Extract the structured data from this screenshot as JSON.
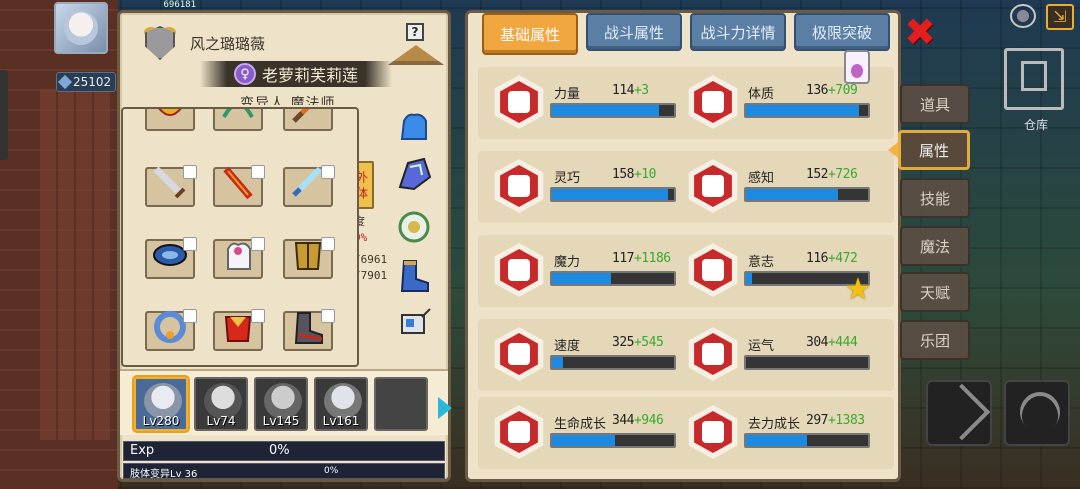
{
  "hud": {
    "hp_text": "696181",
    "power_value": "25102"
  },
  "character": {
    "class_name": "风之璐璐薇",
    "hero_name": "老萝莉芙莉莲",
    "hero_symbol": "♀",
    "subtitle": "变异人 魔法师",
    "help_glyph": "?",
    "extra_tab_label": "外 体",
    "partial_texts": [
      "度",
      "0%",
      "/6961",
      "/7901"
    ]
  },
  "team": [
    {
      "level": "Lv280",
      "selected": true
    },
    {
      "level": "Lv74",
      "selected": false
    },
    {
      "level": "Lv145",
      "selected": false
    },
    {
      "level": "Lv161",
      "selected": false
    },
    {
      "level": "",
      "selected": false
    }
  ],
  "exp": {
    "label": "Exp",
    "value": "0%"
  },
  "limb": {
    "label": "肢体变异Lv 36",
    "value": "0%"
  },
  "tabs": [
    {
      "label": "基础属性",
      "active": true
    },
    {
      "label": "战斗属性",
      "active": false
    },
    {
      "label": "战斗力详情",
      "active": false
    },
    {
      "label": "极限突破",
      "active": false
    }
  ],
  "stats": [
    {
      "name": "力量",
      "base": "114",
      "bonus": "+3",
      "fill": 0.88,
      "icon": "strength-arm-icon"
    },
    {
      "name": "体质",
      "base": "136",
      "bonus": "+709",
      "fill": 0.93,
      "icon": "constitution-body-icon"
    },
    {
      "name": "灵巧",
      "base": "158",
      "bonus": "+10",
      "fill": 0.95,
      "icon": "agility-runner-icon"
    },
    {
      "name": "感知",
      "base": "152",
      "bonus": "+726",
      "fill": 0.75,
      "icon": "perception-eye-icon"
    },
    {
      "name": "魔力",
      "base": "117",
      "bonus": "+1186",
      "fill": 0.48,
      "icon": "magic-swirl-icon"
    },
    {
      "name": "意志",
      "base": "116",
      "bonus": "+472",
      "fill": 0.05,
      "icon": "will-head-icon"
    },
    {
      "name": "速度",
      "base": "325",
      "bonus": "+545",
      "fill": 0.09,
      "icon": "speed-wing-icon"
    },
    {
      "name": "运气",
      "base": "304",
      "bonus": "+444",
      "fill": 0.0,
      "icon": "luck-clover-icon"
    },
    {
      "name": "生命成长",
      "base": "344",
      "bonus": "+946",
      "fill": 0.52,
      "icon": "life-heart-icon"
    },
    {
      "name": "去力成长",
      "base": "297",
      "bonus": "+1383",
      "fill": 0.5,
      "icon": "stamina-figure-icon"
    }
  ],
  "side_menu": [
    {
      "label": "道具",
      "active": false
    },
    {
      "label": "属性",
      "active": true
    },
    {
      "label": "技能",
      "active": false
    },
    {
      "label": "魔法",
      "active": false
    },
    {
      "label": "天赋",
      "active": false
    },
    {
      "label": "乐团",
      "active": false
    }
  ],
  "warehouse_label": "仓库",
  "close_glyph": "✖",
  "star_glyph": "★",
  "exit_glyph": "⇲",
  "colors": {
    "panel_bg": "#eee3c8",
    "active_tab": "#f2a640",
    "inactive_tab": "#5a7ea4",
    "stat_bar_fill": "#1c8ae0",
    "bonus_green": "#3aa830",
    "icon_red": "#c72a2a"
  }
}
